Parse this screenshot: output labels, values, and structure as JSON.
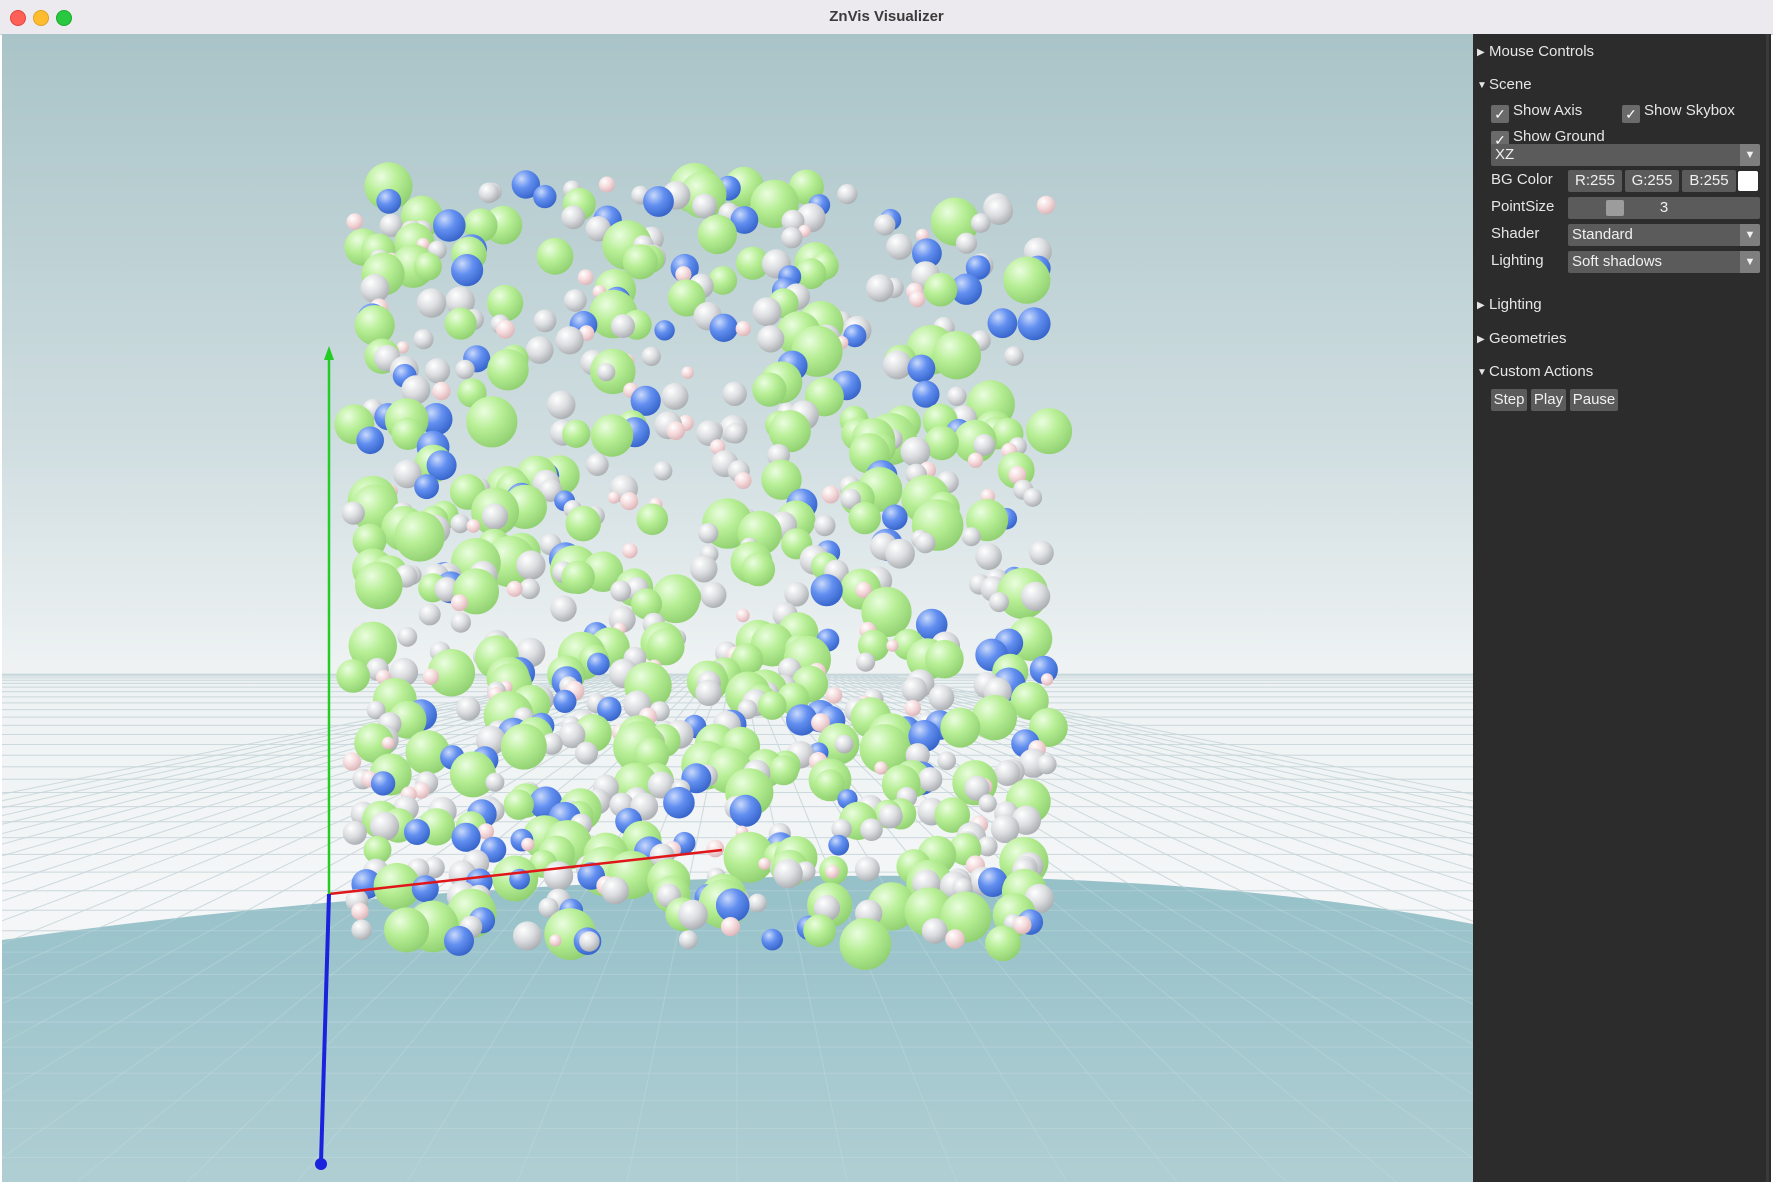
{
  "window": {
    "title": "ZnVis Visualizer"
  },
  "panel": {
    "mouse_controls": "Mouse Controls",
    "scene": {
      "header": "Scene",
      "show_axis": {
        "label": "Show Axis",
        "checked": true
      },
      "show_skybox": {
        "label": "Show Skybox",
        "checked": true
      },
      "show_ground": {
        "label": "Show Ground",
        "checked": true
      },
      "ground_plane": "XZ",
      "bg_color": {
        "label": "BG Color",
        "r": "R:255",
        "g": "G:255",
        "b": "B:255",
        "swatch": "#ffffff"
      },
      "point_size": {
        "label": "PointSize",
        "value": "3"
      },
      "shader": {
        "label": "Shader",
        "value": "Standard"
      },
      "lighting": {
        "label": "Lighting",
        "value": "Soft shadows"
      }
    },
    "lighting_header": "Lighting",
    "geometries_header": "Geometries",
    "custom_actions": {
      "header": "Custom Actions",
      "step": "Step",
      "play": "Play",
      "pause": "Pause"
    }
  },
  "icons": {
    "collapsed": "triangle-right-icon",
    "expanded": "triangle-down-icon",
    "dropdown": "chevron-down-icon",
    "checkmark": "checkmark-icon"
  },
  "colors": {
    "particle_green": "#b5ee95",
    "particle_blue": "#5b8eea",
    "particle_grey": "#d7dadd",
    "particle_pink": "#f4d6d8",
    "axis_x": "#e0161a",
    "axis_y": "#22cc22",
    "axis_z": "#1a22dd",
    "panel_bg": "#2c2c2c"
  }
}
